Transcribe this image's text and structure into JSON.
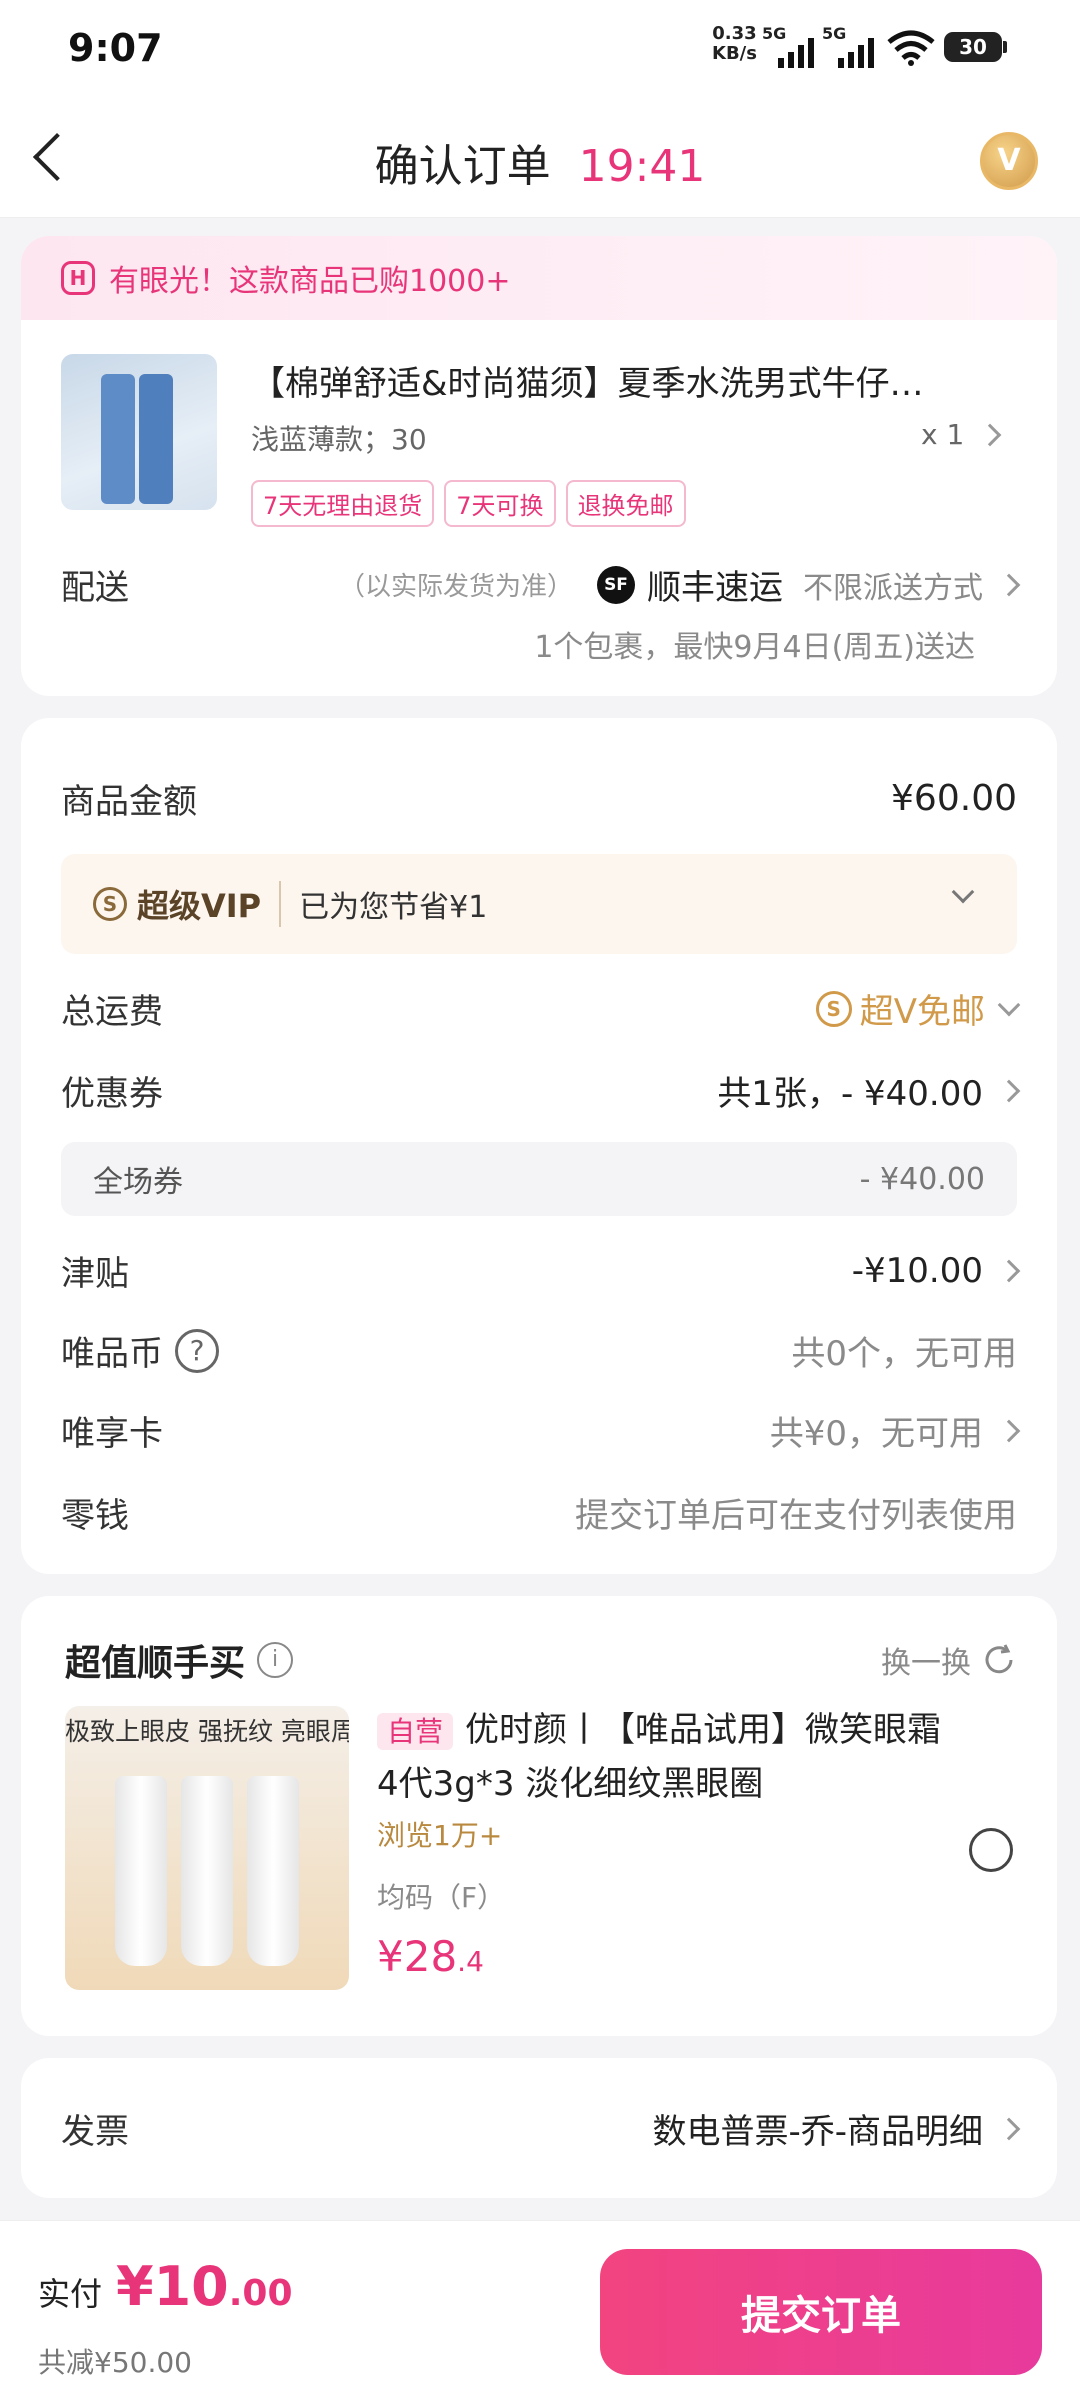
{
  "status_bar": {
    "time": "9:07",
    "net_speed_top": "0.33",
    "net_speed_bottom": "KB/s",
    "sig1": "5G",
    "sig2": "5G",
    "battery": "30"
  },
  "header": {
    "title": "确认订单",
    "countdown": "19:41"
  },
  "banner": {
    "text": "有眼光！这款商品已购1000+"
  },
  "product": {
    "title": "【棉弹舒适&时尚猫须】夏季水洗男式牛仔…",
    "spec": "浅蓝薄款；30",
    "qty": "x 1",
    "tags": [
      "7天无理由退货",
      "7天可换",
      "退换免邮"
    ]
  },
  "delivery": {
    "label": "配送",
    "note": "（以实际发货为准）",
    "courier": "顺丰速运",
    "courier_logo": "SF",
    "method": "不限派送方式",
    "eta": "1个包裹，最快9月4日(周五)送达"
  },
  "price": {
    "goods_label": "商品金额",
    "goods_value": "¥60.00",
    "vip_label": "超级VIP",
    "vip_saved": "已为您节省¥1",
    "shipping_label": "总运费",
    "shipping_value": "超V免邮",
    "coupon_label": "优惠券",
    "coupon_value": "共1张，- ¥40.00",
    "coupon_sub_label": "全场券",
    "coupon_sub_value": "- ¥40.00",
    "allowance_label": "津贴",
    "allowance_value": "-¥10.00",
    "coin_label": "唯品币",
    "coin_value": "共0个，无可用",
    "card_label": "唯享卡",
    "card_value": "共¥0，无可用",
    "change_label": "零钱",
    "change_value": "提交订单后可在支付列表使用"
  },
  "addon": {
    "title": "超值顺手买",
    "refresh": "换一换",
    "image_text": "极致上眼皮 强抚纹 亮眼周",
    "badge": "自营",
    "name": "优时颜丨【唯品试用】微笑眼霜4代3g*3 淡化细纹黑眼圈",
    "views": "浏览1万+",
    "size": "均码（F）",
    "price_int": "¥28",
    "price_dec": ".4"
  },
  "invoice": {
    "label": "发票",
    "value": "数电普票-乔-商品明细"
  },
  "footer": {
    "pay_label": "实付",
    "pay_int": "¥10",
    "pay_dec": ".00",
    "saved": "共减¥50.00",
    "submit": "提交订单"
  },
  "colors": {
    "accent": "#e8357a",
    "gold": "#d19a4a",
    "submit_grad_start": "#f2447f",
    "submit_grad_end": "#e83a9c"
  }
}
